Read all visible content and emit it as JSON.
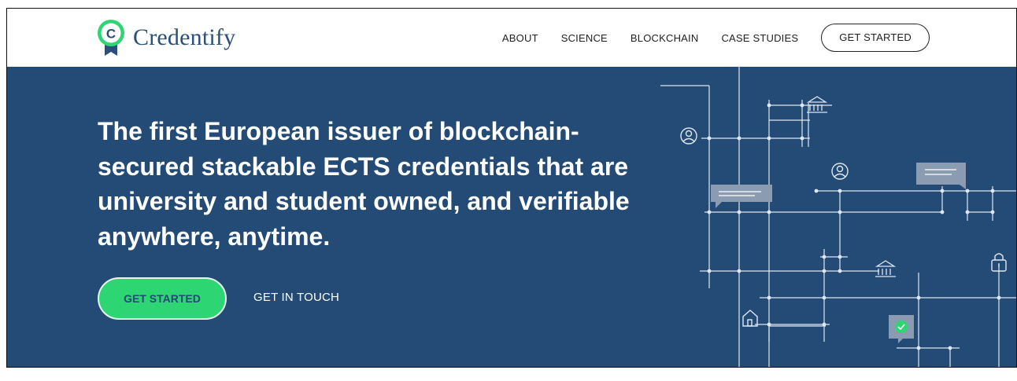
{
  "brand": {
    "name": "Credentify",
    "logo_letter": "C"
  },
  "nav": {
    "items": [
      "ABOUT",
      "SCIENCE",
      "BLOCKCHAIN",
      "CASE STUDIES"
    ],
    "cta_label": "GET STARTED"
  },
  "hero": {
    "headline": "The first European issuer of blockchain-secured stackable ECTS credentials that are university and student owned, and verifiable anywhere, anytime.",
    "primary_cta": "GET STARTED",
    "secondary_cta": "GET IN TOUCH"
  },
  "colors": {
    "hero_bg": "#234b76",
    "accent_green": "#2ed573",
    "logo_navy": "#2a4f7b",
    "line": "#dfe8f2"
  },
  "icons": [
    "person-icon",
    "bank-icon",
    "chat-bubble-icon",
    "padlock-icon",
    "house-icon",
    "check-icon"
  ]
}
